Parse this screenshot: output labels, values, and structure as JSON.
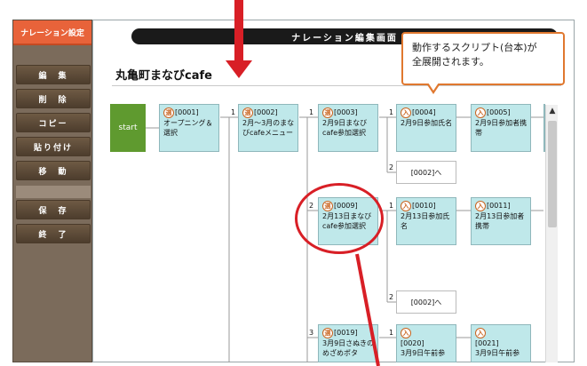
{
  "sidebar": {
    "header": "ナレーション設定",
    "buttons": [
      "編　集",
      "削　除",
      "コピー",
      "貼り付け",
      "移　動",
      "保　存",
      "終　了"
    ]
  },
  "topbar": {
    "title": "ナレーション編集画面"
  },
  "project": {
    "title": "丸亀町まなびcafe"
  },
  "callout": {
    "text_line1": "動作するスクリプト(台本)が",
    "text_line2": "全展開されます。"
  },
  "flow": {
    "start_label": "start",
    "badges": {
      "select": "選",
      "input": "入"
    },
    "nodes": {
      "n0001": {
        "id": "[0001]",
        "text": "オープニング＆選択"
      },
      "n0002": {
        "id": "[0002]",
        "text": "2月～3月のまなびcafeメニュー"
      },
      "n0003": {
        "id": "[0003]",
        "text": "2月9日まなびcafe参加選択"
      },
      "n0004": {
        "id": "[0004]",
        "text": "2月9日参加氏名"
      },
      "n0005": {
        "id": "[0005]",
        "text": "2月9日参加者携帯"
      },
      "n0009": {
        "id": "[0009]",
        "text": "2月13日まなびcafe参加選択"
      },
      "n0010": {
        "id": "[0010]",
        "text": "2月13日参加氏名"
      },
      "n0011": {
        "id": "[0011]",
        "text": "2月13日参加者携帯"
      },
      "n0019": {
        "id": "[0019]",
        "text": "3月9日さぬきのめざめポタ"
      },
      "n0020": {
        "id": "[0020]",
        "text": "3月9日午前参"
      },
      "n0021": {
        "id": "[0021]",
        "text": "3月9日午前参"
      }
    },
    "refs": {
      "r1": "[0002]へ",
      "r2": "[0002]へ"
    },
    "branch_numbers": {
      "b1": "1",
      "b2": "1",
      "b3": "1",
      "b4": "1",
      "b5": "2",
      "b6": "2",
      "b7": "1",
      "b8": "2",
      "b9": "3",
      "b10": "1"
    }
  },
  "scrollbar": {
    "up_arrow": "▲"
  },
  "colors": {
    "accent": "#e8633a",
    "arrow": "#d81f26",
    "node": "#bfe8ea",
    "start": "#5f9a2f"
  }
}
